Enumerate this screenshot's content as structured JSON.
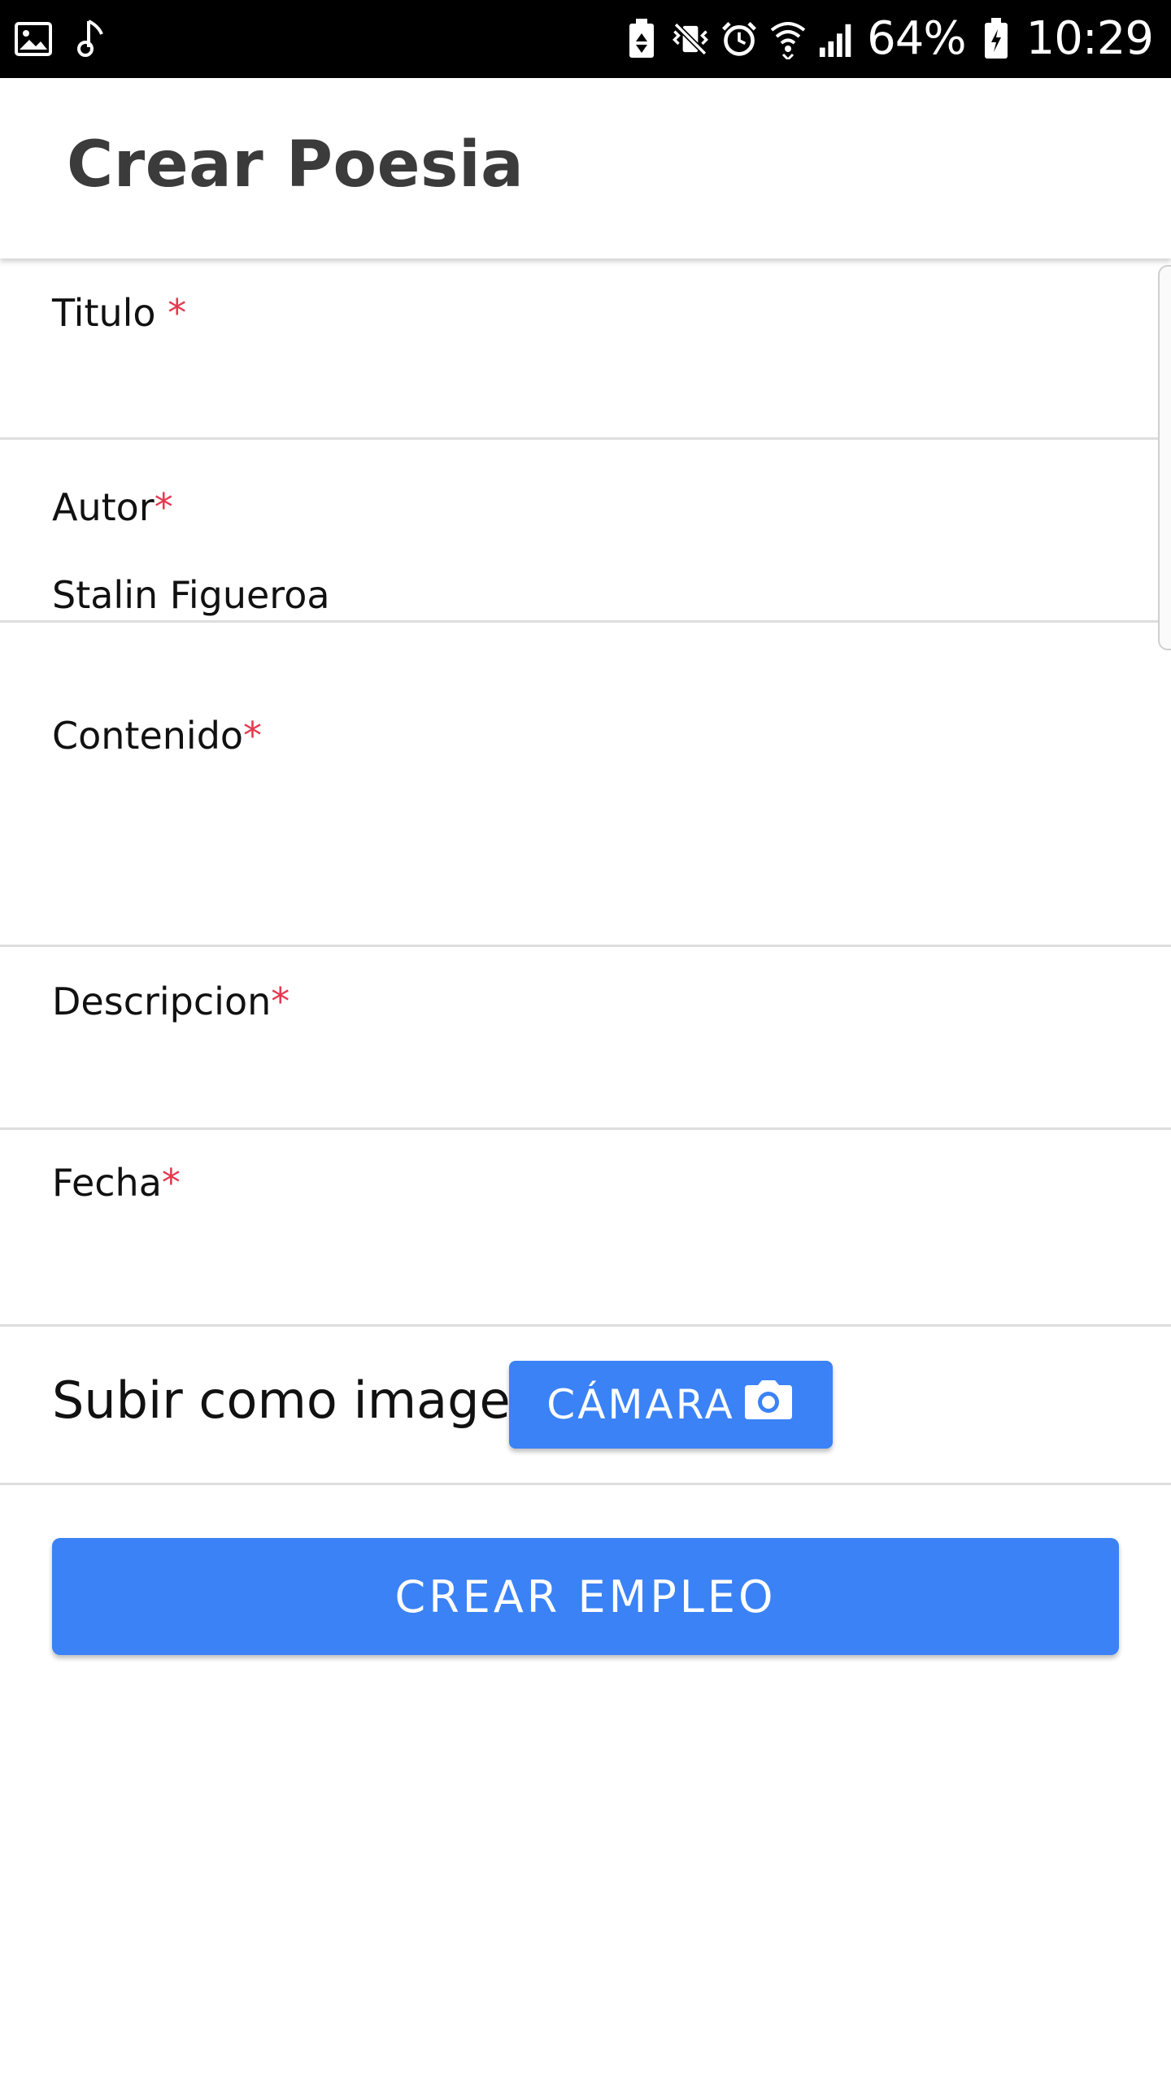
{
  "status_bar": {
    "battery_percent": "64%",
    "time": "10:29",
    "icons_left": [
      "gallery-icon",
      "music-note-icon"
    ],
    "icons_right": [
      "battery-saver-icon",
      "vibrate-mute-icon",
      "alarm-icon",
      "wifi-icon",
      "signal-icon",
      "battery-icon"
    ]
  },
  "app_bar": {
    "title": "Crear Poesia"
  },
  "form": {
    "titulo": {
      "label": "Titulo ",
      "required_mark": "*",
      "value": ""
    },
    "autor": {
      "label": "Autor",
      "required_mark": "*",
      "value": "Stalin Figueroa"
    },
    "contenido": {
      "label": "Contenido",
      "required_mark": "*",
      "value": ""
    },
    "descripcion": {
      "label": "Descripcion",
      "required_mark": "*",
      "value": ""
    },
    "fecha": {
      "label": "Fecha",
      "required_mark": "*",
      "value": ""
    }
  },
  "upload": {
    "label": "Subir como imagen",
    "camera_button_label": "CÁMARA",
    "camera_icon": "camera-icon"
  },
  "submit": {
    "label": "CREAR EMPLEO"
  },
  "colors": {
    "primary": "#3b82f6",
    "required": "#e53950",
    "divider": "#dedede",
    "status_bar": "#000000"
  }
}
